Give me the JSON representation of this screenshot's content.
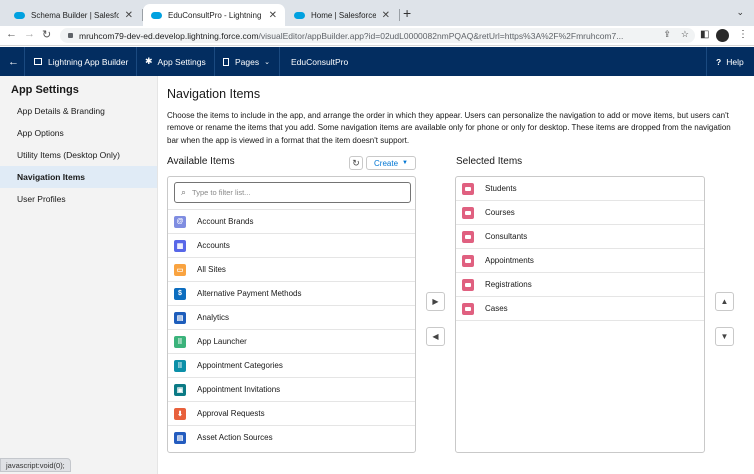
{
  "browser": {
    "tabs": [
      {
        "title": "Schema Builder | Salesforce",
        "close": "✕"
      },
      {
        "title": "EduConsultPro - Lightning App",
        "close": "✕"
      },
      {
        "title": "Home | Salesforce",
        "close": "✕"
      }
    ],
    "new_tab": "+",
    "tab_menu": "⌄",
    "url_host": "mruhcom79-dev-ed.develop.lightning.force.com",
    "url_path": "/visualEditor/appBuilder.app?id=02udL0000082nmPQAQ&retUrl=https%3A%2F%2Fmruhcom7...",
    "status_text": "javascript:void(0);"
  },
  "header": {
    "back": "←",
    "builder_label": "Lightning App Builder",
    "app_settings_label": "App Settings",
    "pages_label": "Pages",
    "app_name": "EduConsultPro",
    "help_label": "Help",
    "help_mark": "?"
  },
  "sidebar": {
    "title": "App Settings",
    "items": [
      {
        "label": "App Details & Branding"
      },
      {
        "label": "App Options"
      },
      {
        "label": "Utility Items (Desktop Only)"
      },
      {
        "label": "Navigation Items"
      },
      {
        "label": "User Profiles"
      }
    ],
    "active_index": 3
  },
  "main": {
    "heading": "Navigation Items",
    "description": "Choose the items to include in the app, and arrange the order in which they appear. Users can personalize the navigation to add or move items, but users can't remove or rename the items that you add. Some navigation items are available only for phone or only for desktop. These items are dropped from the navigation bar when the app is viewed in a format that the item doesn't support.",
    "available_label": "Available Items",
    "create_label": "Create",
    "filter_placeholder": "Type to filter list...",
    "available_items": [
      {
        "label": "Account Brands",
        "color": "#7f8de1",
        "glyph": "@"
      },
      {
        "label": "Accounts",
        "color": "#5867e8",
        "glyph": "▦"
      },
      {
        "label": "All Sites",
        "color": "#f9a340",
        "glyph": "▭"
      },
      {
        "label": "Alternative Payment Methods",
        "color": "#0c6dbf",
        "glyph": "$"
      },
      {
        "label": "Analytics",
        "color": "#1e5ebc",
        "glyph": "▤"
      },
      {
        "label": "App Launcher",
        "color": "#3bb37b",
        "glyph": "⠿"
      },
      {
        "label": "Appointment Categories",
        "color": "#0b8fa8",
        "glyph": "⠿"
      },
      {
        "label": "Appointment Invitations",
        "color": "#0b7a85",
        "glyph": "▣"
      },
      {
        "label": "Approval Requests",
        "color": "#e8603c",
        "glyph": "⬇"
      },
      {
        "label": "Asset Action Sources",
        "color": "#245cbf",
        "glyph": "▤"
      }
    ],
    "selected_label": "Selected Items",
    "selected_items": [
      {
        "label": "Students"
      },
      {
        "label": "Courses"
      },
      {
        "label": "Consultants"
      },
      {
        "label": "Appointments"
      },
      {
        "label": "Registrations"
      },
      {
        "label": "Cases"
      }
    ],
    "selected_icon_color": "#e06080"
  }
}
